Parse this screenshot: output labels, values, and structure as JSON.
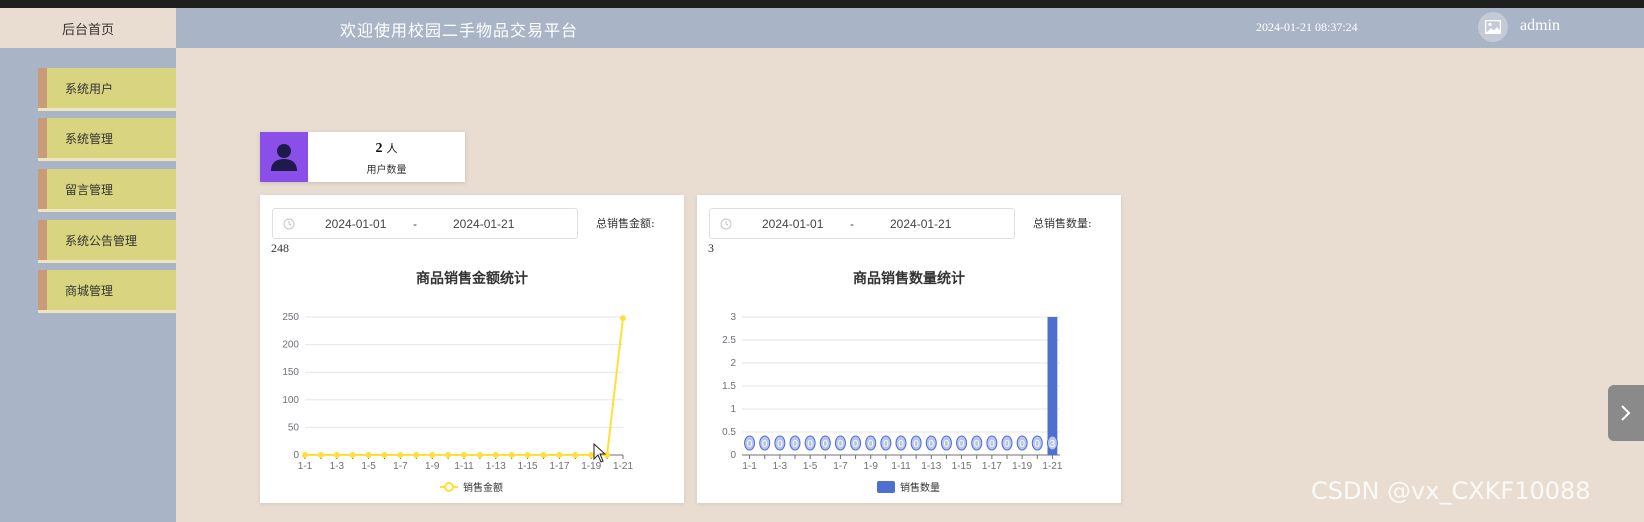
{
  "header": {
    "home_label": "后台首页",
    "app_title": "欢迎使用校园二手物品交易平台",
    "datetime": "2024-01-21 08:37:24",
    "username": "admin",
    "avatar_icon": "image-icon"
  },
  "sidebar": {
    "items": [
      {
        "label": "系统用户"
      },
      {
        "label": "系统管理"
      },
      {
        "label": "留言管理"
      },
      {
        "label": "系统公告管理"
      },
      {
        "label": "商城管理"
      }
    ]
  },
  "stats": {
    "user_count": "2",
    "user_unit": "人",
    "user_label": "用户数量",
    "icon": "person-icon",
    "icon_color": "#8a4fe8"
  },
  "sales_amount": {
    "start_date": "2024-01-01",
    "separator": "-",
    "end_date": "2024-01-21",
    "total_label": "总销售金额:",
    "total_value": "248"
  },
  "sales_quantity": {
    "start_date": "2024-01-01",
    "separator": "-",
    "end_date": "2024-01-21",
    "total_label": "总销售数量:",
    "total_value": "3"
  },
  "chart_data": [
    {
      "type": "line",
      "title": "商品销售金额统计",
      "color": "#ffe135",
      "categories": [
        "1-1",
        "1-2",
        "1-3",
        "1-4",
        "1-5",
        "1-6",
        "1-7",
        "1-8",
        "1-9",
        "1-10",
        "1-11",
        "1-12",
        "1-13",
        "1-14",
        "1-15",
        "1-16",
        "1-17",
        "1-18",
        "1-19",
        "1-20",
        "1-21"
      ],
      "tick_labels": [
        "1-1",
        "1-3",
        "1-5",
        "1-7",
        "1-9",
        "1-11",
        "1-13",
        "1-15",
        "1-17",
        "1-19",
        "1-21"
      ],
      "series": [
        {
          "name": "销售金额",
          "values": [
            0,
            0,
            0,
            0,
            0,
            0,
            0,
            0,
            0,
            0,
            0,
            0,
            0,
            0,
            0,
            0,
            0,
            0,
            0,
            0,
            248
          ]
        }
      ],
      "yticks": [
        "0",
        "50",
        "100",
        "150",
        "200",
        "250"
      ],
      "ylim": [
        0,
        250
      ],
      "grid": true,
      "legend": "bottom-center"
    },
    {
      "type": "bar",
      "title": "商品销售数量统计",
      "color": "#4f6fd0",
      "categories": [
        "1-1",
        "1-2",
        "1-3",
        "1-4",
        "1-5",
        "1-6",
        "1-7",
        "1-8",
        "1-9",
        "1-10",
        "1-11",
        "1-12",
        "1-13",
        "1-14",
        "1-15",
        "1-16",
        "1-17",
        "1-18",
        "1-19",
        "1-20",
        "1-21"
      ],
      "tick_labels": [
        "1-1",
        "1-3",
        "1-5",
        "1-7",
        "1-9",
        "1-11",
        "1-13",
        "1-15",
        "1-17",
        "1-19",
        "1-21"
      ],
      "series": [
        {
          "name": "销售数量",
          "values": [
            0,
            0,
            0,
            0,
            0,
            0,
            0,
            0,
            0,
            0,
            0,
            0,
            0,
            0,
            0,
            0,
            0,
            0,
            0,
            0,
            3
          ]
        }
      ],
      "data_labels": [
        "0",
        "0",
        "0",
        "0",
        "0",
        "0",
        "0",
        "0",
        "0",
        "0",
        "0",
        "0",
        "0",
        "0",
        "0",
        "0",
        "0",
        "0",
        "0",
        "0",
        "3"
      ],
      "yticks": [
        "0",
        "0.5",
        "1",
        "1.5",
        "2",
        "2.5",
        "3"
      ],
      "ylim": [
        0,
        3
      ],
      "grid": true,
      "legend": "bottom-center"
    }
  ],
  "watermark": "CSDN @vx_CXKF10088",
  "next_icon": "chevron-right-icon"
}
